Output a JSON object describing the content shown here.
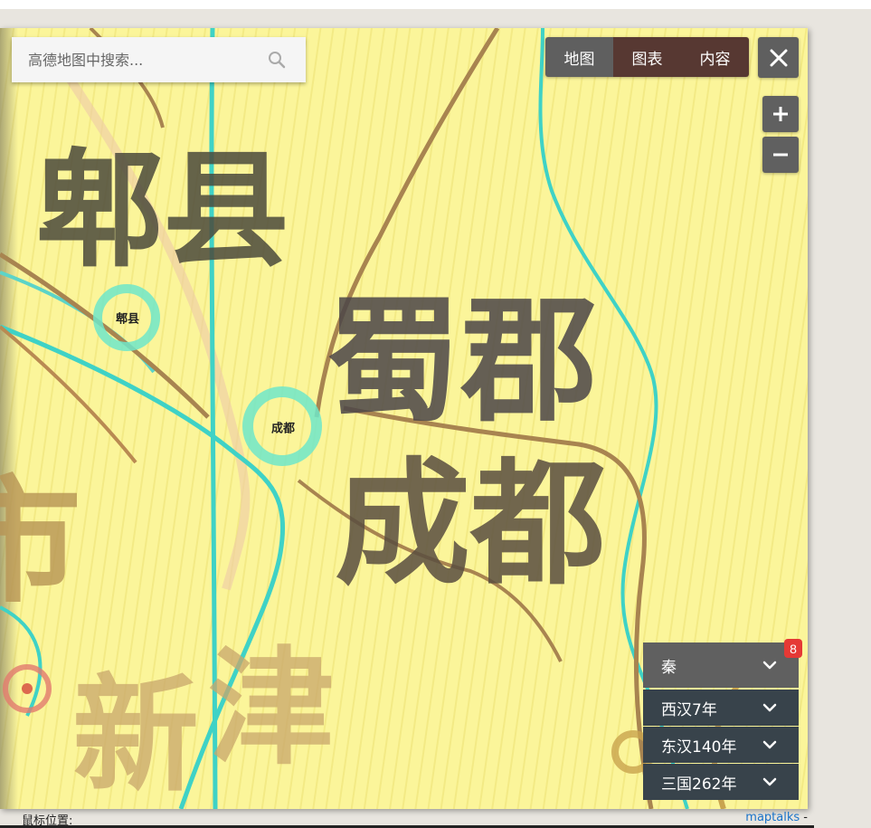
{
  "search": {
    "placeholder": "高德地图中搜索..."
  },
  "tabs": [
    "地图",
    "图表",
    "内容"
  ],
  "zoom": {
    "in_label": "+",
    "out_label": "−"
  },
  "map_labels": {
    "big": [
      "郫县",
      "蜀郡",
      "成都",
      "市",
      "新",
      "津"
    ],
    "cities": [
      "郫县",
      "成都"
    ]
  },
  "dynasties": {
    "active": "秦",
    "badge": "8",
    "others": [
      "西汉7年",
      "东汉140年",
      "三国262年"
    ]
  },
  "status": {
    "mouse_position_label": "鼠标位置:",
    "attribution_link": "maptalks",
    "attribution_suffix": "-"
  },
  "colors": {
    "map_bg": "#fbf59a",
    "tab_active": "#5f5f5f",
    "tab_inactive": "#573832",
    "dynasty_active": "#606060",
    "dynasty_item": "#38434b",
    "badge": "#e53935",
    "link": "#1a73c9"
  },
  "icons": {
    "search": "search-icon",
    "close": "close-icon",
    "zoom_in": "plus-icon",
    "zoom_out": "minus-icon",
    "dropdown": "chevron-down-icon"
  }
}
